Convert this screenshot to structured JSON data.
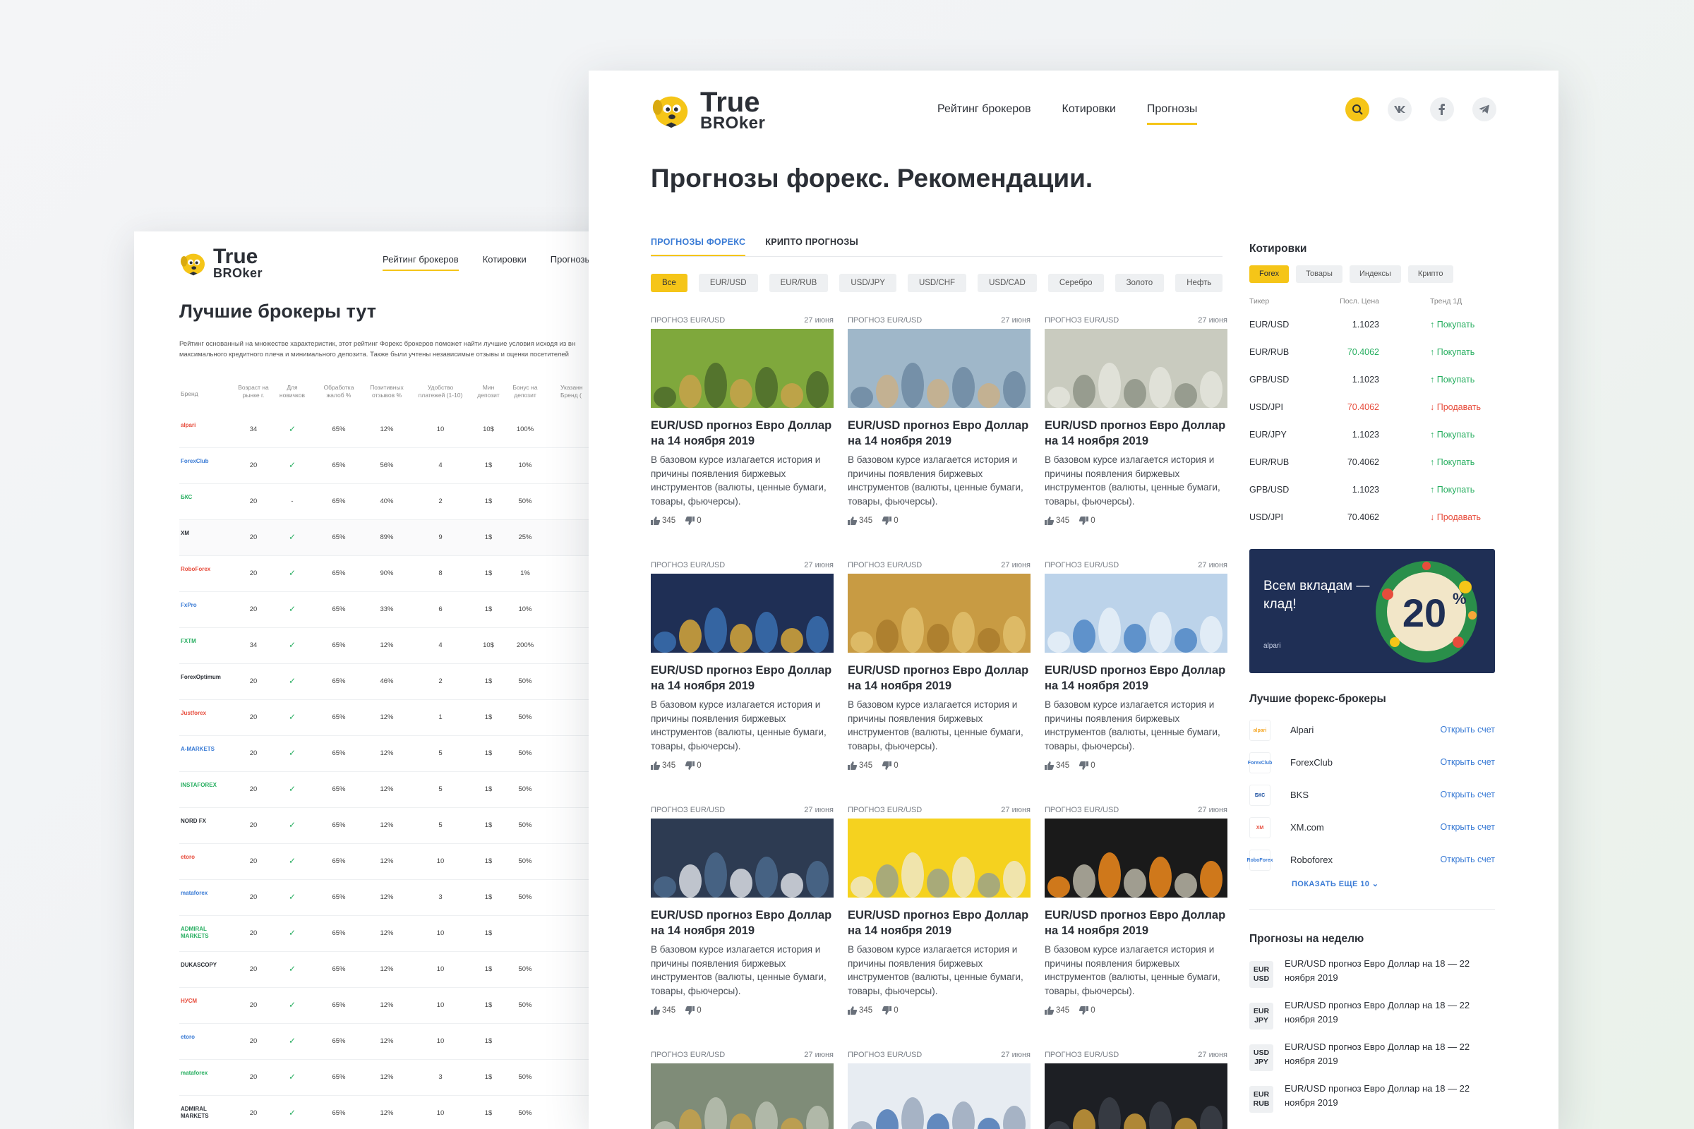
{
  "back": {
    "logo": {
      "line1": "True",
      "line2": "BROker"
    },
    "nav": [
      "Рейтинг брокеров",
      "Котировки",
      "Прогнозы"
    ],
    "title": "Лучшие брокеры тут",
    "description": "Рейтинг основанный на множестве характеристик, этот рейтинг Форекс брокеров поможет найти лучшие условия исходя из вн максимального кредитного плеча и минимального депозита. Также были учтены независимые отзывы и оценки посетителей",
    "columns": {
      "brand": "Бренд",
      "age": "Возраст на рынке г.",
      "novice": "Для новичков",
      "complaints": "Обработка жалоб %",
      "positive": "Позитивных отзывов %",
      "payments": "Удобство платежей (1-10)",
      "min_deposit": "Мин депозит",
      "bonus": "Бонус на депозит",
      "last": "Указанн Бренд ("
    },
    "rows": [
      {
        "brand": "alpari",
        "age": "34",
        "novice": "✓",
        "complaints": "65%",
        "positive": "12%",
        "payments": "10",
        "min_deposit": "10$",
        "bonus": "100%"
      },
      {
        "brand": "ForexClub",
        "age": "20",
        "novice": "✓",
        "complaints": "65%",
        "positive": "56%",
        "payments": "4",
        "min_deposit": "1$",
        "bonus": "10%"
      },
      {
        "brand": "БКС",
        "age": "20",
        "novice": "-",
        "complaints": "65%",
        "positive": "40%",
        "payments": "2",
        "min_deposit": "1$",
        "bonus": "50%"
      },
      {
        "brand": "XM",
        "age": "20",
        "novice": "✓",
        "complaints": "65%",
        "positive": "89%",
        "payments": "9",
        "min_deposit": "1$",
        "bonus": "25%"
      },
      {
        "brand": "RoboForex",
        "age": "20",
        "novice": "✓",
        "complaints": "65%",
        "positive": "90%",
        "payments": "8",
        "min_deposit": "1$",
        "bonus": "1%"
      },
      {
        "brand": "FxPro",
        "age": "20",
        "novice": "✓",
        "complaints": "65%",
        "positive": "33%",
        "payments": "6",
        "min_deposit": "1$",
        "bonus": "10%"
      },
      {
        "brand": "FXTM",
        "age": "34",
        "novice": "✓",
        "complaints": "65%",
        "positive": "12%",
        "payments": "4",
        "min_deposit": "10$",
        "bonus": "200%"
      },
      {
        "brand": "ForexOptimum",
        "age": "20",
        "novice": "✓",
        "complaints": "65%",
        "positive": "46%",
        "payments": "2",
        "min_deposit": "1$",
        "bonus": "50%"
      },
      {
        "brand": "Justforex",
        "age": "20",
        "novice": "✓",
        "complaints": "65%",
        "positive": "12%",
        "payments": "1",
        "min_deposit": "1$",
        "bonus": "50%"
      },
      {
        "brand": "A-MARKETS",
        "age": "20",
        "novice": "✓",
        "complaints": "65%",
        "positive": "12%",
        "payments": "5",
        "min_deposit": "1$",
        "bonus": "50%"
      },
      {
        "brand": "INSTAFOREX",
        "age": "20",
        "novice": "✓",
        "complaints": "65%",
        "positive": "12%",
        "payments": "5",
        "min_deposit": "1$",
        "bonus": "50%"
      },
      {
        "brand": "NORD FX",
        "age": "20",
        "novice": "✓",
        "complaints": "65%",
        "positive": "12%",
        "payments": "5",
        "min_deposit": "1$",
        "bonus": "50%"
      },
      {
        "brand": "etoro",
        "age": "20",
        "novice": "✓",
        "complaints": "65%",
        "positive": "12%",
        "payments": "10",
        "min_deposit": "1$",
        "bonus": "50%"
      },
      {
        "brand": "mataforex",
        "age": "20",
        "novice": "✓",
        "complaints": "65%",
        "positive": "12%",
        "payments": "3",
        "min_deposit": "1$",
        "bonus": "50%"
      },
      {
        "brand": "ADMIRAL MARKETS",
        "age": "20",
        "novice": "✓",
        "complaints": "65%",
        "positive": "12%",
        "payments": "10",
        "min_deposit": "1$",
        "bonus": ""
      },
      {
        "brand": "DUKASCOPY",
        "age": "20",
        "novice": "✓",
        "complaints": "65%",
        "positive": "12%",
        "payments": "10",
        "min_deposit": "1$",
        "bonus": "50%"
      },
      {
        "brand": "НУСМ",
        "age": "20",
        "novice": "✓",
        "complaints": "65%",
        "positive": "12%",
        "payments": "10",
        "min_deposit": "1$",
        "bonus": "50%"
      },
      {
        "brand": "etoro",
        "age": "20",
        "novice": "✓",
        "complaints": "65%",
        "positive": "12%",
        "payments": "10",
        "min_deposit": "1$",
        "bonus": ""
      },
      {
        "brand": "mataforex",
        "age": "20",
        "novice": "✓",
        "complaints": "65%",
        "positive": "12%",
        "payments": "3",
        "min_deposit": "1$",
        "bonus": "50%"
      },
      {
        "brand": "ADMIRAL MARKETS",
        "age": "20",
        "novice": "✓",
        "complaints": "65%",
        "positive": "12%",
        "payments": "10",
        "min_deposit": "1$",
        "bonus": "50%"
      }
    ]
  },
  "front": {
    "logo": {
      "line1": "True",
      "line2": "BROker"
    },
    "nav": [
      "Рейтинг брокеров",
      "Котировки",
      "Прогнозы"
    ],
    "icons": [
      "search-icon",
      "vk-icon",
      "facebook-icon",
      "telegram-icon"
    ],
    "title": "Прогнозы форекс. Рекомендации.",
    "tabs": [
      "ПРОГНОЗЫ ФОРЕКС",
      "КРИПТО ПРОГНОЗЫ"
    ],
    "chips": [
      "Все",
      "EUR/USD",
      "EUR/RUB",
      "USD/JPY",
      "USD/CHF",
      "USD/CAD",
      "Серебро",
      "Золото",
      "Нефть"
    ],
    "card": {
      "category": "ПРОГНОЗ EUR/USD",
      "date": "27 июня",
      "title": "EUR/USD прогноз Евро Доллар на 14 ноября 2019",
      "text": "В базовом курсе излагается история и причины появления биржевых инструментов (валюты, ценные бумаги, товары, фьючерсы).",
      "likes": "345",
      "dislikes": "0"
    },
    "card_images": [
      "plants-coins",
      "coins-bokeh",
      "dollar-bills",
      "coins-chart",
      "gold-coins",
      "city-coins",
      "business-meeting",
      "yellow-money-jar",
      "burning-money",
      "bitcoin-dollars",
      "calculator-desk",
      "hands-coins"
    ],
    "quotes": {
      "title": "Котировки",
      "tabs": [
        "Forex",
        "Товары",
        "Индексы",
        "Крипто"
      ],
      "head": {
        "ticker": "Тикер",
        "price": "Посл. Цена",
        "trend": "Тренд 1Д"
      },
      "rows": [
        {
          "ticker": "EUR/USD",
          "price": "1.1023",
          "price_color": "",
          "trend": "↑ Покупать",
          "dir": "up"
        },
        {
          "ticker": "EUR/RUB",
          "price": "70.4062",
          "price_color": "g",
          "trend": "↑ Покупать",
          "dir": "up"
        },
        {
          "ticker": "GPB/USD",
          "price": "1.1023",
          "price_color": "",
          "trend": "↑ Покупать",
          "dir": "up"
        },
        {
          "ticker": "USD/JPI",
          "price": "70.4062",
          "price_color": "r",
          "trend": "↓ Продавать",
          "dir": "dn"
        },
        {
          "ticker": "EUR/JPY",
          "price": "1.1023",
          "price_color": "",
          "trend": "↑ Покупать",
          "dir": "up"
        },
        {
          "ticker": "EUR/RUB",
          "price": "70.4062",
          "price_color": "",
          "trend": "↑ Покупать",
          "dir": "up"
        },
        {
          "ticker": "GPB/USD",
          "price": "1.1023",
          "price_color": "",
          "trend": "↑ Покупать",
          "dir": "up"
        },
        {
          "ticker": "USD/JPI",
          "price": "70.4062",
          "price_color": "",
          "trend": "↓ Продавать",
          "dir": "dn"
        }
      ]
    },
    "banner": {
      "text": "Всем вкладам — клад!",
      "percent": "20",
      "brand": "alpari"
    },
    "brokers": {
      "title": "Лучшие форекс-брокеры",
      "items": [
        {
          "logo": "alpari",
          "name": "Alpari",
          "action": "Открыть счет"
        },
        {
          "logo": "ForexClub",
          "name": "ForexClub",
          "action": "Открыть счет"
        },
        {
          "logo": "БКС",
          "name": "BKS",
          "action": "Открыть счет"
        },
        {
          "logo": "XM",
          "name": "XM.com",
          "action": "Открыть счет"
        },
        {
          "logo": "RoboForex",
          "name": "Roboforex",
          "action": "Открыть счет"
        }
      ],
      "more": "ПОКАЗАТЬ ЕЩЕ 10"
    },
    "week": {
      "title": "Прогнозы на неделю",
      "items": [
        {
          "pair1": "EUR",
          "pair2": "USD",
          "text": "EUR/USD прогноз Евро Доллар на 18 — 22 ноября 2019"
        },
        {
          "pair1": "EUR",
          "pair2": "JPY",
          "text": "EUR/USD прогноз Евро Доллар на 18 — 22 ноября 2019"
        },
        {
          "pair1": "USD",
          "pair2": "JPY",
          "text": "EUR/USD прогноз Евро Доллар на 18 — 22 ноября 2019"
        },
        {
          "pair1": "EUR",
          "pair2": "RUB",
          "text": "EUR/USD прогноз Евро Доллар на 18 — 22 ноября 2019"
        }
      ]
    },
    "colors": {
      "accent": "#f5c518",
      "link": "#3a7bd5",
      "up": "#27ae60",
      "down": "#e74c3c"
    }
  }
}
